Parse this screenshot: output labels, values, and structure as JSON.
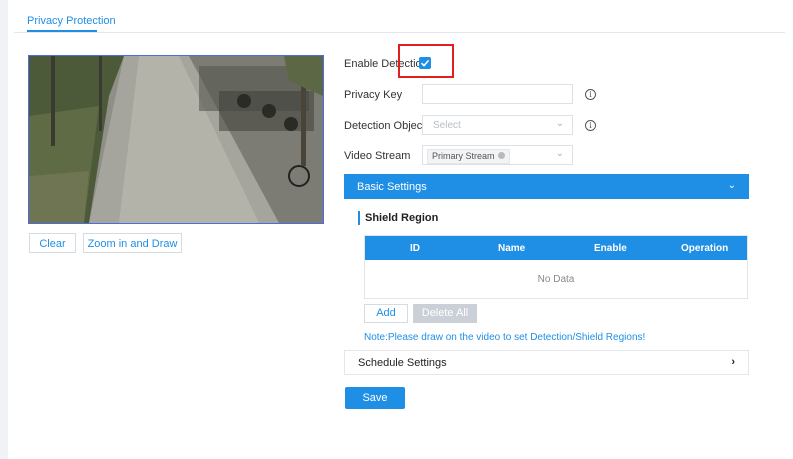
{
  "tabs": {
    "active_label": "Privacy Protection"
  },
  "video_tools": {
    "clear_label": "Clear",
    "zoom_label": "Zoom in and Draw"
  },
  "form": {
    "enable_detection_label": "Enable Detection",
    "enable_detection_checked": true,
    "privacy_key_label": "Privacy Key",
    "privacy_key_value": "",
    "detection_object_label": "Detection Object",
    "detection_object_placeholder": "Select",
    "video_stream_label": "Video Stream",
    "video_stream_tag": "Primary Stream"
  },
  "basic_settings": {
    "title": "Basic Settings"
  },
  "shield_region": {
    "title": "Shield Region",
    "columns": [
      "ID",
      "Name",
      "Enable",
      "Operation"
    ],
    "empty_text": "No Data",
    "add_label": "Add",
    "delete_all_label": "Delete All",
    "note": "Note:Please draw on the video to set Detection/Shield Regions!"
  },
  "schedule_settings": {
    "title": "Schedule Settings"
  },
  "actions": {
    "save_label": "Save"
  },
  "colors": {
    "accent": "#1f8fe6",
    "highlight": "#e0201f"
  }
}
